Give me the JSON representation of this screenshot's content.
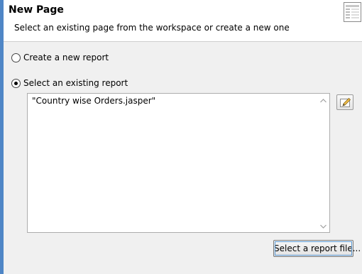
{
  "header": {
    "title": "New Page",
    "description": "Select an existing page from the workspace or create a new one",
    "icon": "wizard-page-icon"
  },
  "options": {
    "create_new": {
      "label": "Create a new report",
      "selected": false
    },
    "select_existing": {
      "label": "Select an existing report",
      "selected": true
    }
  },
  "report_list": {
    "items": [
      "\"Country wise Orders.jasper\""
    ]
  },
  "buttons": {
    "edit_icon": "edit-pencil-icon",
    "select_file_label": "Select a report file..."
  },
  "colors": {
    "accent_bar": "#4f86c6",
    "background": "#f0f0f0",
    "header_background": "#ffffff",
    "focus_border": "#5b9bd5"
  }
}
